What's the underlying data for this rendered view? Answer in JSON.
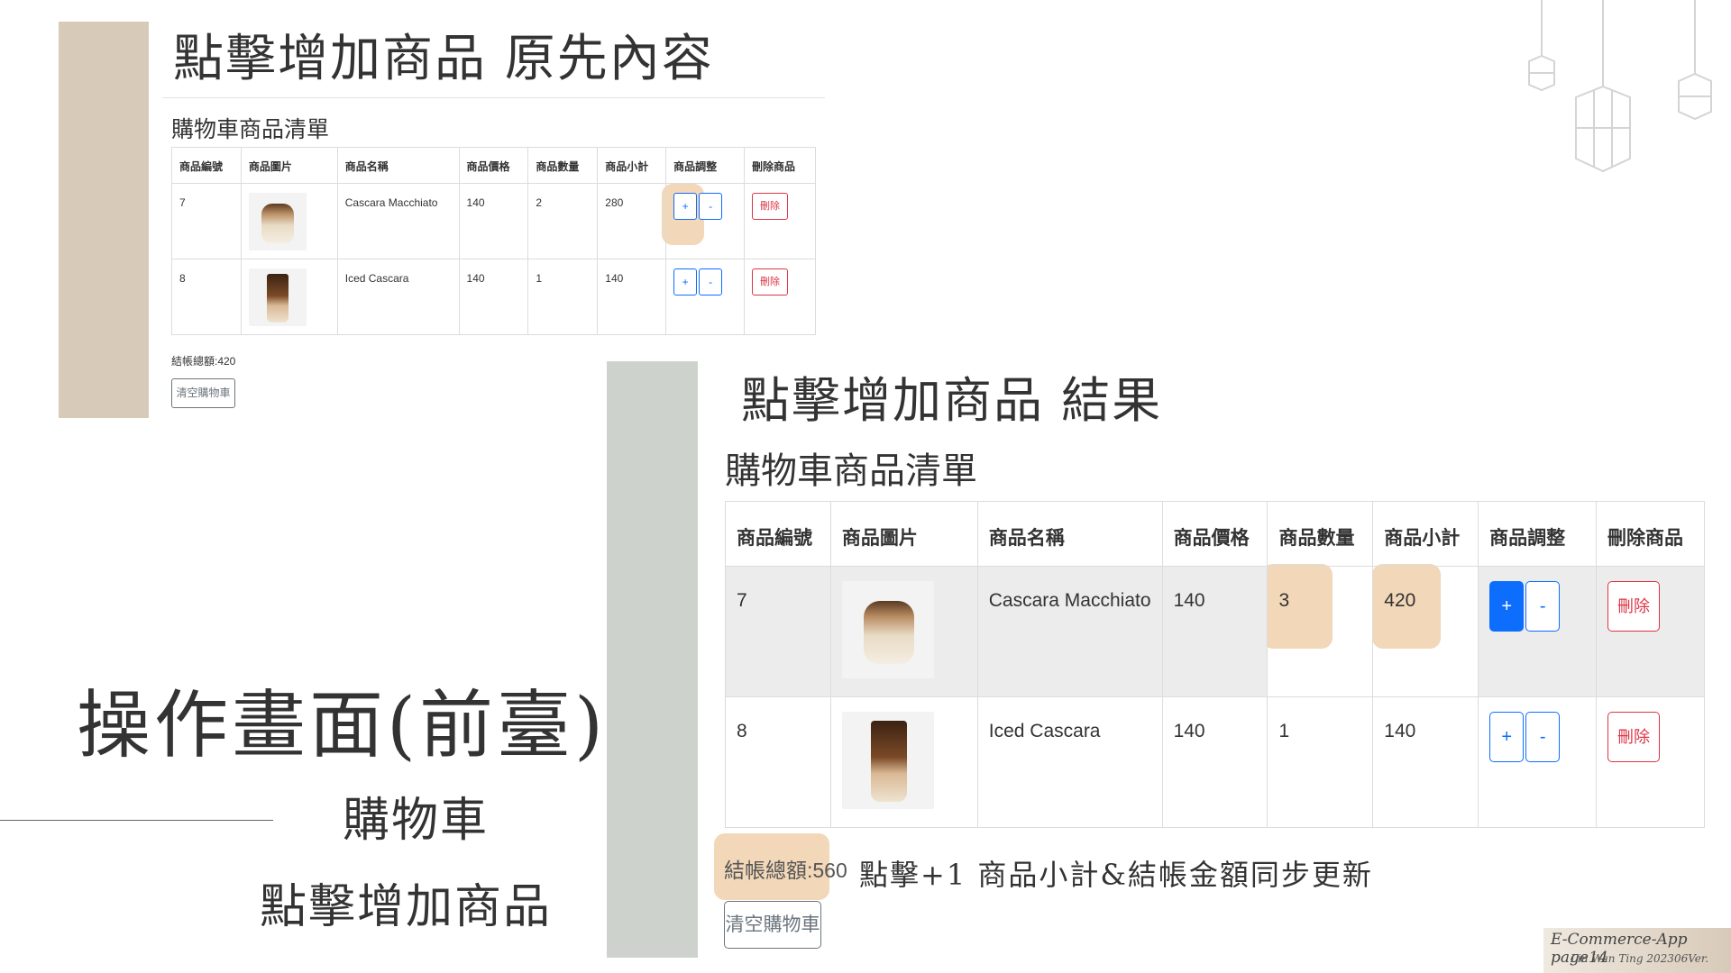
{
  "slide": {
    "title_original": "點擊增加商品 原先內容",
    "title_result": "點擊增加商品 結果",
    "heading": "操作畫面(前臺)",
    "subheading1": "購物車",
    "subheading2": "點擊增加商品",
    "note": "點擊+1 商品小計&結帳金額同步更新",
    "footer_line1": "E-Commerce-App page14",
    "footer_line2": "Lin Wan Ting 202306Ver.",
    "colors": {
      "tan_bar": "#d8cab9",
      "sage_bar": "#cdd3cc",
      "highlight": "#f2d7b8"
    }
  },
  "cart_before": {
    "title": "購物車商品清單",
    "headers": [
      "商品編號",
      "商品圖片",
      "商品名稱",
      "商品價格",
      "商品數量",
      "商品小計",
      "商品調整",
      "刪除商品"
    ],
    "rows": [
      {
        "id": "7",
        "image": "cascara-macchiato-image",
        "name": "Cascara Macchiato",
        "price": "140",
        "qty": "2",
        "subtotal": "280",
        "plus": "+",
        "minus": "-",
        "delete": "刪除"
      },
      {
        "id": "8",
        "image": "iced-cascara-image",
        "name": "Iced Cascara",
        "price": "140",
        "qty": "1",
        "subtotal": "140",
        "plus": "+",
        "minus": "-",
        "delete": "刪除"
      }
    ],
    "total": "結帳總額:420",
    "clear_button": "清空購物車"
  },
  "cart_after": {
    "title": "購物車商品清單",
    "headers": [
      "商品編號",
      "商品圖片",
      "商品名稱",
      "商品價格",
      "商品數量",
      "商品小計",
      "商品調整",
      "刪除商品"
    ],
    "rows": [
      {
        "id": "7",
        "image": "cascara-macchiato-image",
        "name": "Cascara Macchiato",
        "price": "140",
        "qty": "3",
        "subtotal": "420",
        "plus": "+",
        "minus": "-",
        "delete": "刪除"
      },
      {
        "id": "8",
        "image": "iced-cascara-image",
        "name": "Iced Cascara",
        "price": "140",
        "qty": "1",
        "subtotal": "140",
        "plus": "+",
        "minus": "-",
        "delete": "刪除"
      }
    ],
    "total": "結帳總額:560",
    "clear_button": "清空購物車"
  }
}
